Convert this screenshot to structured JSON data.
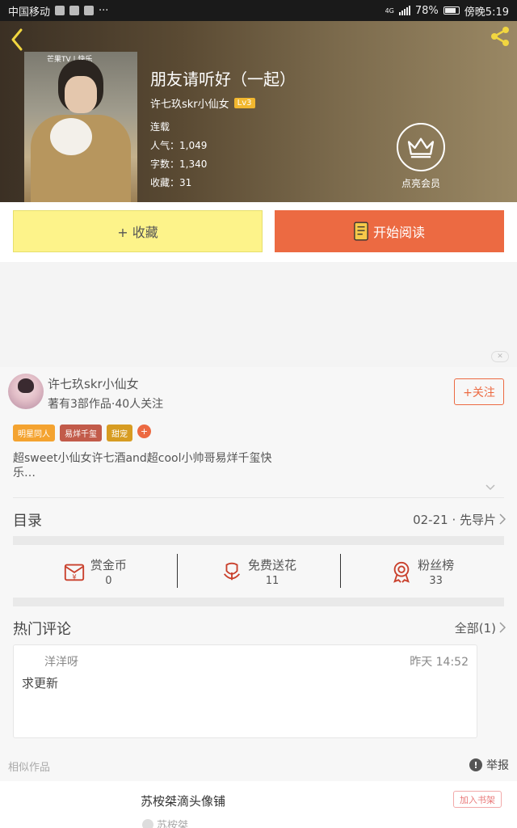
{
  "status_bar": {
    "carrier": "中国移动",
    "network": "4G",
    "battery": "78%",
    "time": "傍晚5:19"
  },
  "book": {
    "title": "朋友请听好（一起）",
    "author": "许七玖skr小仙女",
    "author_level": "Lv3",
    "status": "连载",
    "popularity_label": "人气：",
    "popularity": "1,049",
    "words_label": "字数：",
    "words": "1,340",
    "favorites_label": "收藏：",
    "favorites": "31",
    "cover_tag": "芒果TV | 快乐"
  },
  "vip": {
    "label": "点亮会员"
  },
  "actions": {
    "favorite": "+ 收藏",
    "read": "开始阅读"
  },
  "ad": {
    "close_label": "✕"
  },
  "author_card": {
    "name": "许七玖skr小仙女",
    "summary": "著有3部作品·40人关注",
    "follow": "+关注",
    "tags": [
      {
        "label": "明星同人",
        "color": "#f4a330"
      },
      {
        "label": "易烊千玺",
        "color": "#c25b4a"
      },
      {
        "label": "甜宠",
        "color": "#d79c22"
      }
    ],
    "tag_more": "+",
    "description": "超sweet小仙女许七酒and超cool小帅哥易烊千玺快乐…"
  },
  "toc": {
    "title": "目录",
    "latest": "02-21 · 先导片"
  },
  "stats": [
    {
      "label": "赏金币",
      "value": "0",
      "icon": "coin-envelope-icon"
    },
    {
      "label": "免费送花",
      "value": "11",
      "icon": "flower-icon"
    },
    {
      "label": "粉丝榜",
      "value": "33",
      "icon": "medal-icon"
    }
  ],
  "hot_comments": {
    "title": "热门评论",
    "all": "全部(1)",
    "items": [
      {
        "user": "洋洋呀",
        "time": "昨天 14:52",
        "text": "求更新"
      }
    ]
  },
  "similar": {
    "title": "相似作品",
    "report": "举报",
    "items": [
      {
        "name": "苏桉桀滴头像铺",
        "author": "苏桉桀",
        "action": "加入书架"
      }
    ]
  },
  "colors": {
    "accent": "#ec6a42",
    "favorite_bg": "#fdf38a",
    "level_badge": "#f1b72f"
  }
}
